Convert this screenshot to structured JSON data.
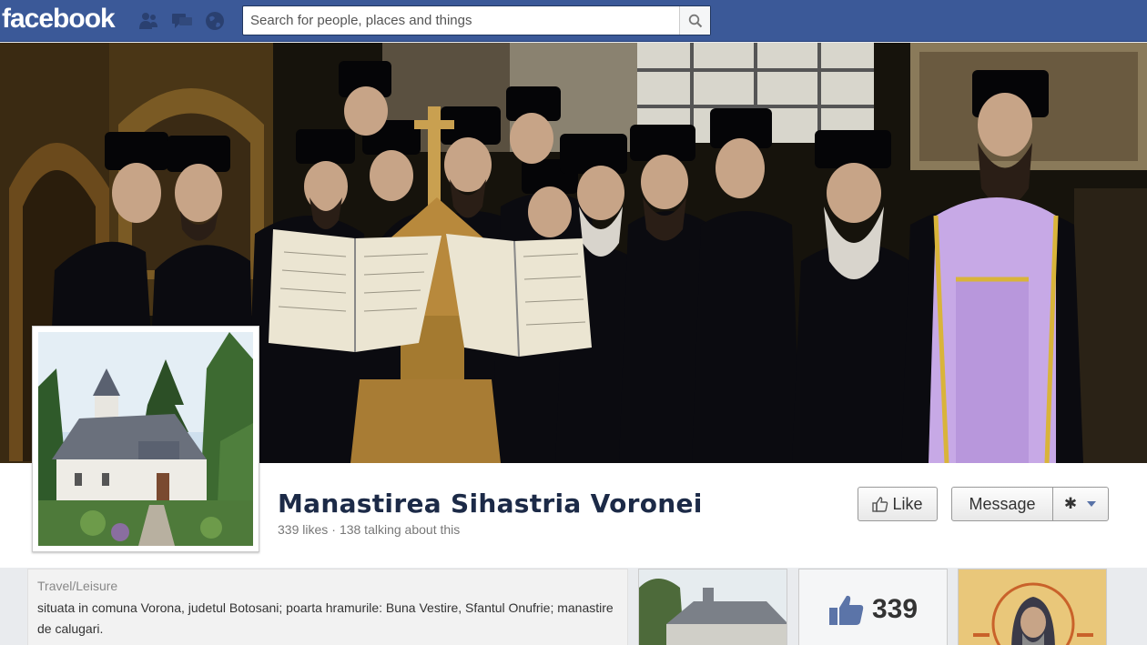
{
  "topbar": {
    "logo": "facebook",
    "search_placeholder": "Search for people, places and things",
    "icons": [
      "friends-icon",
      "messages-icon",
      "notifications-globe-icon",
      "search-icon"
    ],
    "color": "#3b5998"
  },
  "page": {
    "name": "Manastirea Sihastria Voronei",
    "likes": "339 likes",
    "separator": "·",
    "talking": "138 talking about this"
  },
  "actions": {
    "like_label": "Like",
    "message_label": "Message",
    "settings_icon": "gear-icon"
  },
  "about": {
    "category": "Travel/Leisure",
    "description": "situata in comuna Vorona, judetul Botosani; poarta hramurile: Buna Vestire, Sfantul Onufrie; manastire de calugari."
  },
  "likes_box": {
    "count": "339"
  }
}
